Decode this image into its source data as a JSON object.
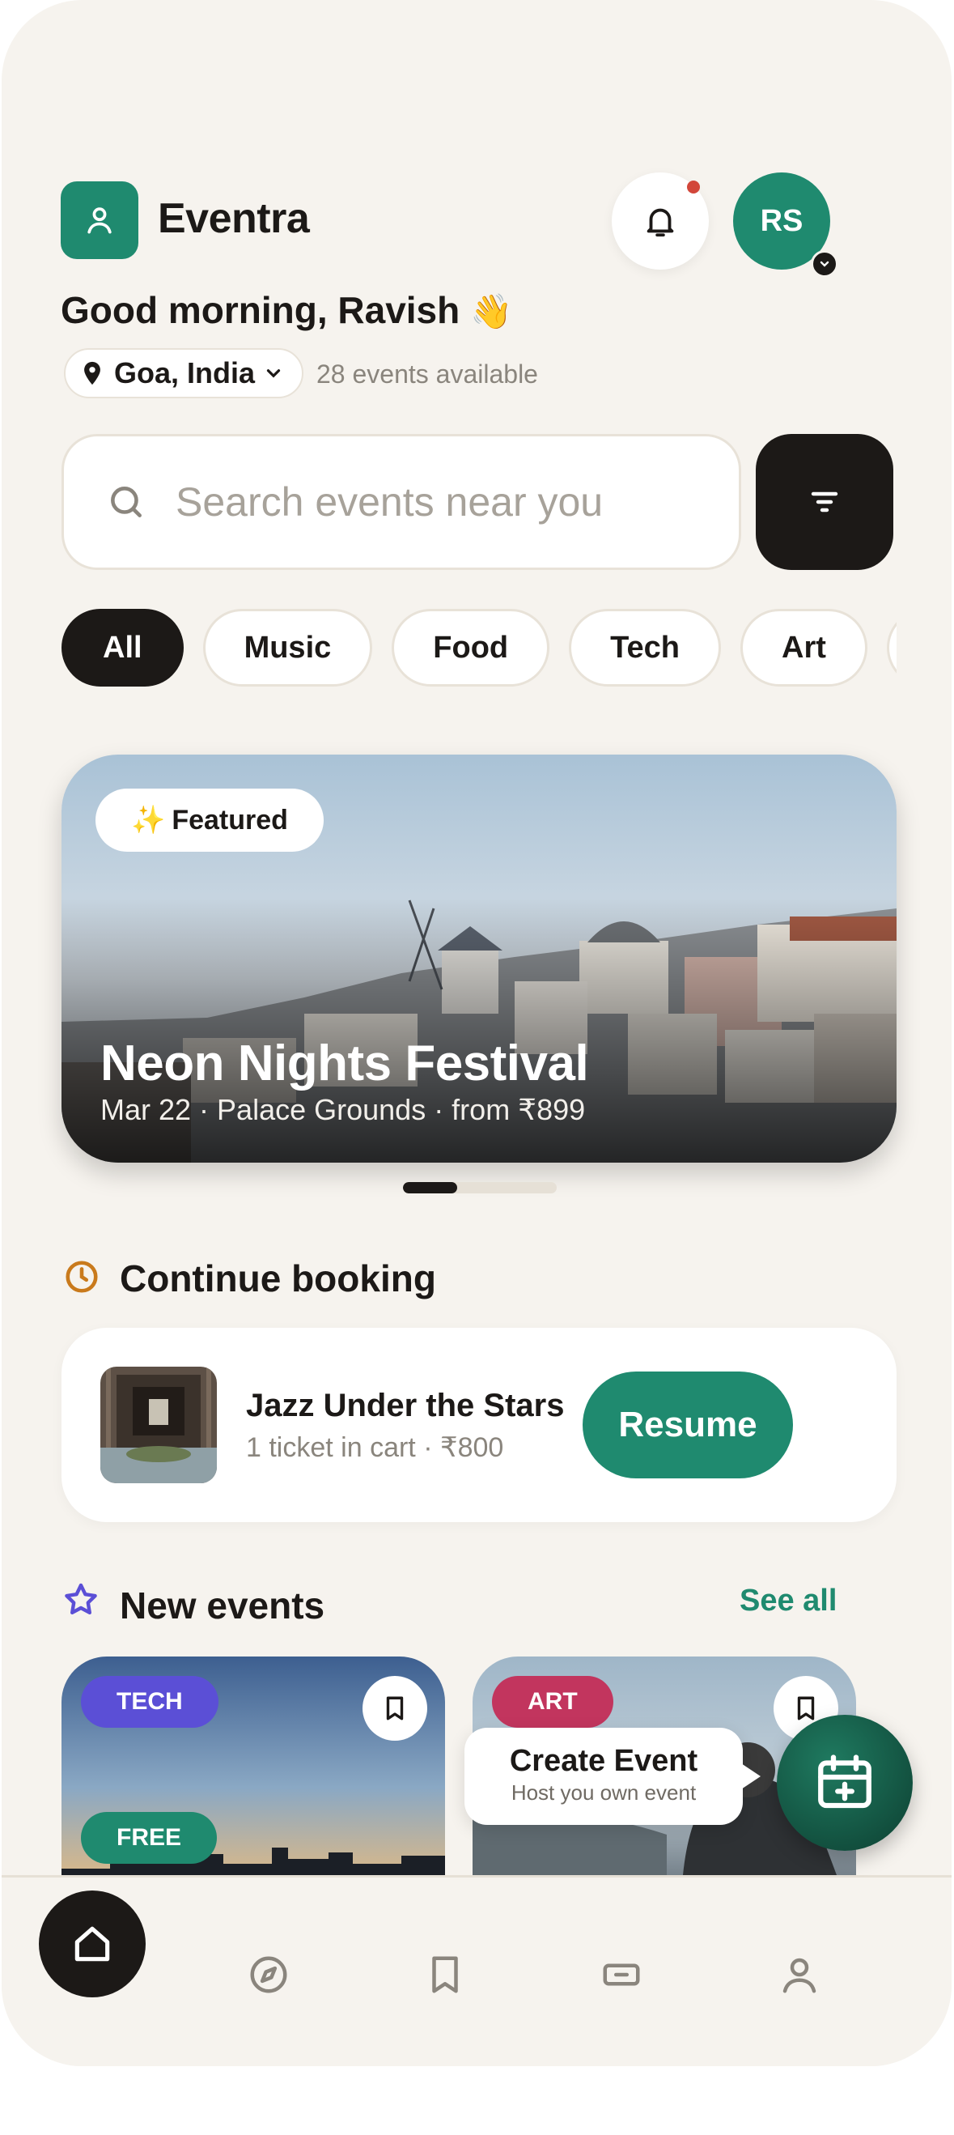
{
  "header": {
    "app_name": "Eventra",
    "avatar_initials": "RS",
    "greeting": "Good morning, Ravish",
    "greeting_emoji": "👋",
    "location": "Goa, India",
    "events_available": "28 events available"
  },
  "search": {
    "placeholder": "Search events near you"
  },
  "categories": [
    "All",
    "Music",
    "Food",
    "Tech",
    "Art"
  ],
  "featured": {
    "badge_icon": "✨",
    "badge": "Featured",
    "title": "Neon Nights Festival",
    "subtitle": "Mar 22 · Palace Grounds · from ₹899",
    "carousel_progress": 0.35
  },
  "continue_booking": {
    "title": "Continue booking",
    "event_name": "Jazz Under the Stars",
    "meta": "1 ticket in cart · ₹800",
    "button": "Resume"
  },
  "new_events": {
    "title": "New events",
    "see_all": "See all",
    "cards": [
      {
        "tag": "TECH",
        "tag_color": "#5b4fd6",
        "price": "FREE",
        "price_color": "#1f8a6f"
      },
      {
        "tag": "ART",
        "tag_color": "#c2355e"
      }
    ]
  },
  "create_event": {
    "title": "Create Event",
    "subtitle": "Host you own event"
  },
  "tabbar": [
    "home-icon",
    "compass-icon",
    "bookmark-icon",
    "ticket-icon",
    "profile-icon"
  ],
  "colors": {
    "brand": "#1f8a6f",
    "dark": "#1c1917",
    "background": "#f6f3ee",
    "accent_orange": "#c97a1c",
    "accent_purple": "#5b4fd6"
  }
}
